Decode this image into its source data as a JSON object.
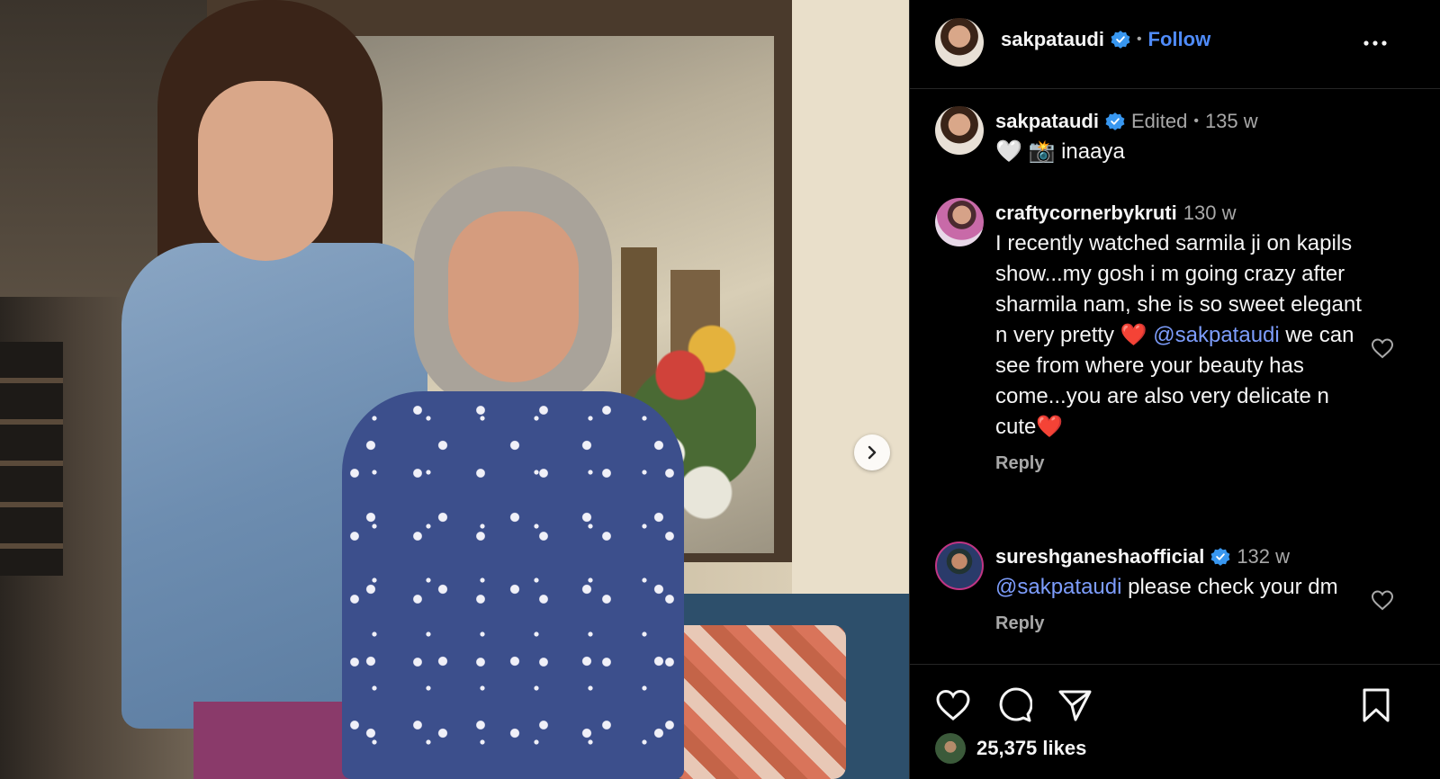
{
  "post": {
    "author": "sakpataudi",
    "follow_label": "Follow",
    "dot": "•",
    "photo_next_icon": "chevron-right-icon"
  },
  "caption": {
    "author": "sakpataudi",
    "edited": "Edited",
    "dot": "•",
    "time": "135 w",
    "text": "🤍 📸 inaaya"
  },
  "comments": [
    {
      "author": "craftycornerbykruti",
      "time": "130 w",
      "text_parts": [
        "I recently watched sarmila ji on kapils show...my gosh i m going crazy after sharmila nam, she is so sweet elegant n very pretty ❤️ ",
        "@sakpataudi",
        " we can see from where your beauty has come...you are also very delicate n cute❤️"
      ],
      "reply_label": "Reply"
    },
    {
      "author": "sureshganeshaofficial",
      "time": "132 w",
      "text_parts": [
        "",
        "@sakpataudi",
        " please check your dm"
      ],
      "reply_label": "Reply"
    }
  ],
  "footer": {
    "likes": "25,375 likes",
    "icons": [
      "heart-icon",
      "comment-icon",
      "share-icon",
      "bookmark-icon"
    ]
  },
  "colors": {
    "background": "#000000",
    "link_blue": "#4f8bf9",
    "mention_blue": "#7d9dfc",
    "muted": "#a8a8a8",
    "verified": "#3897f0"
  }
}
